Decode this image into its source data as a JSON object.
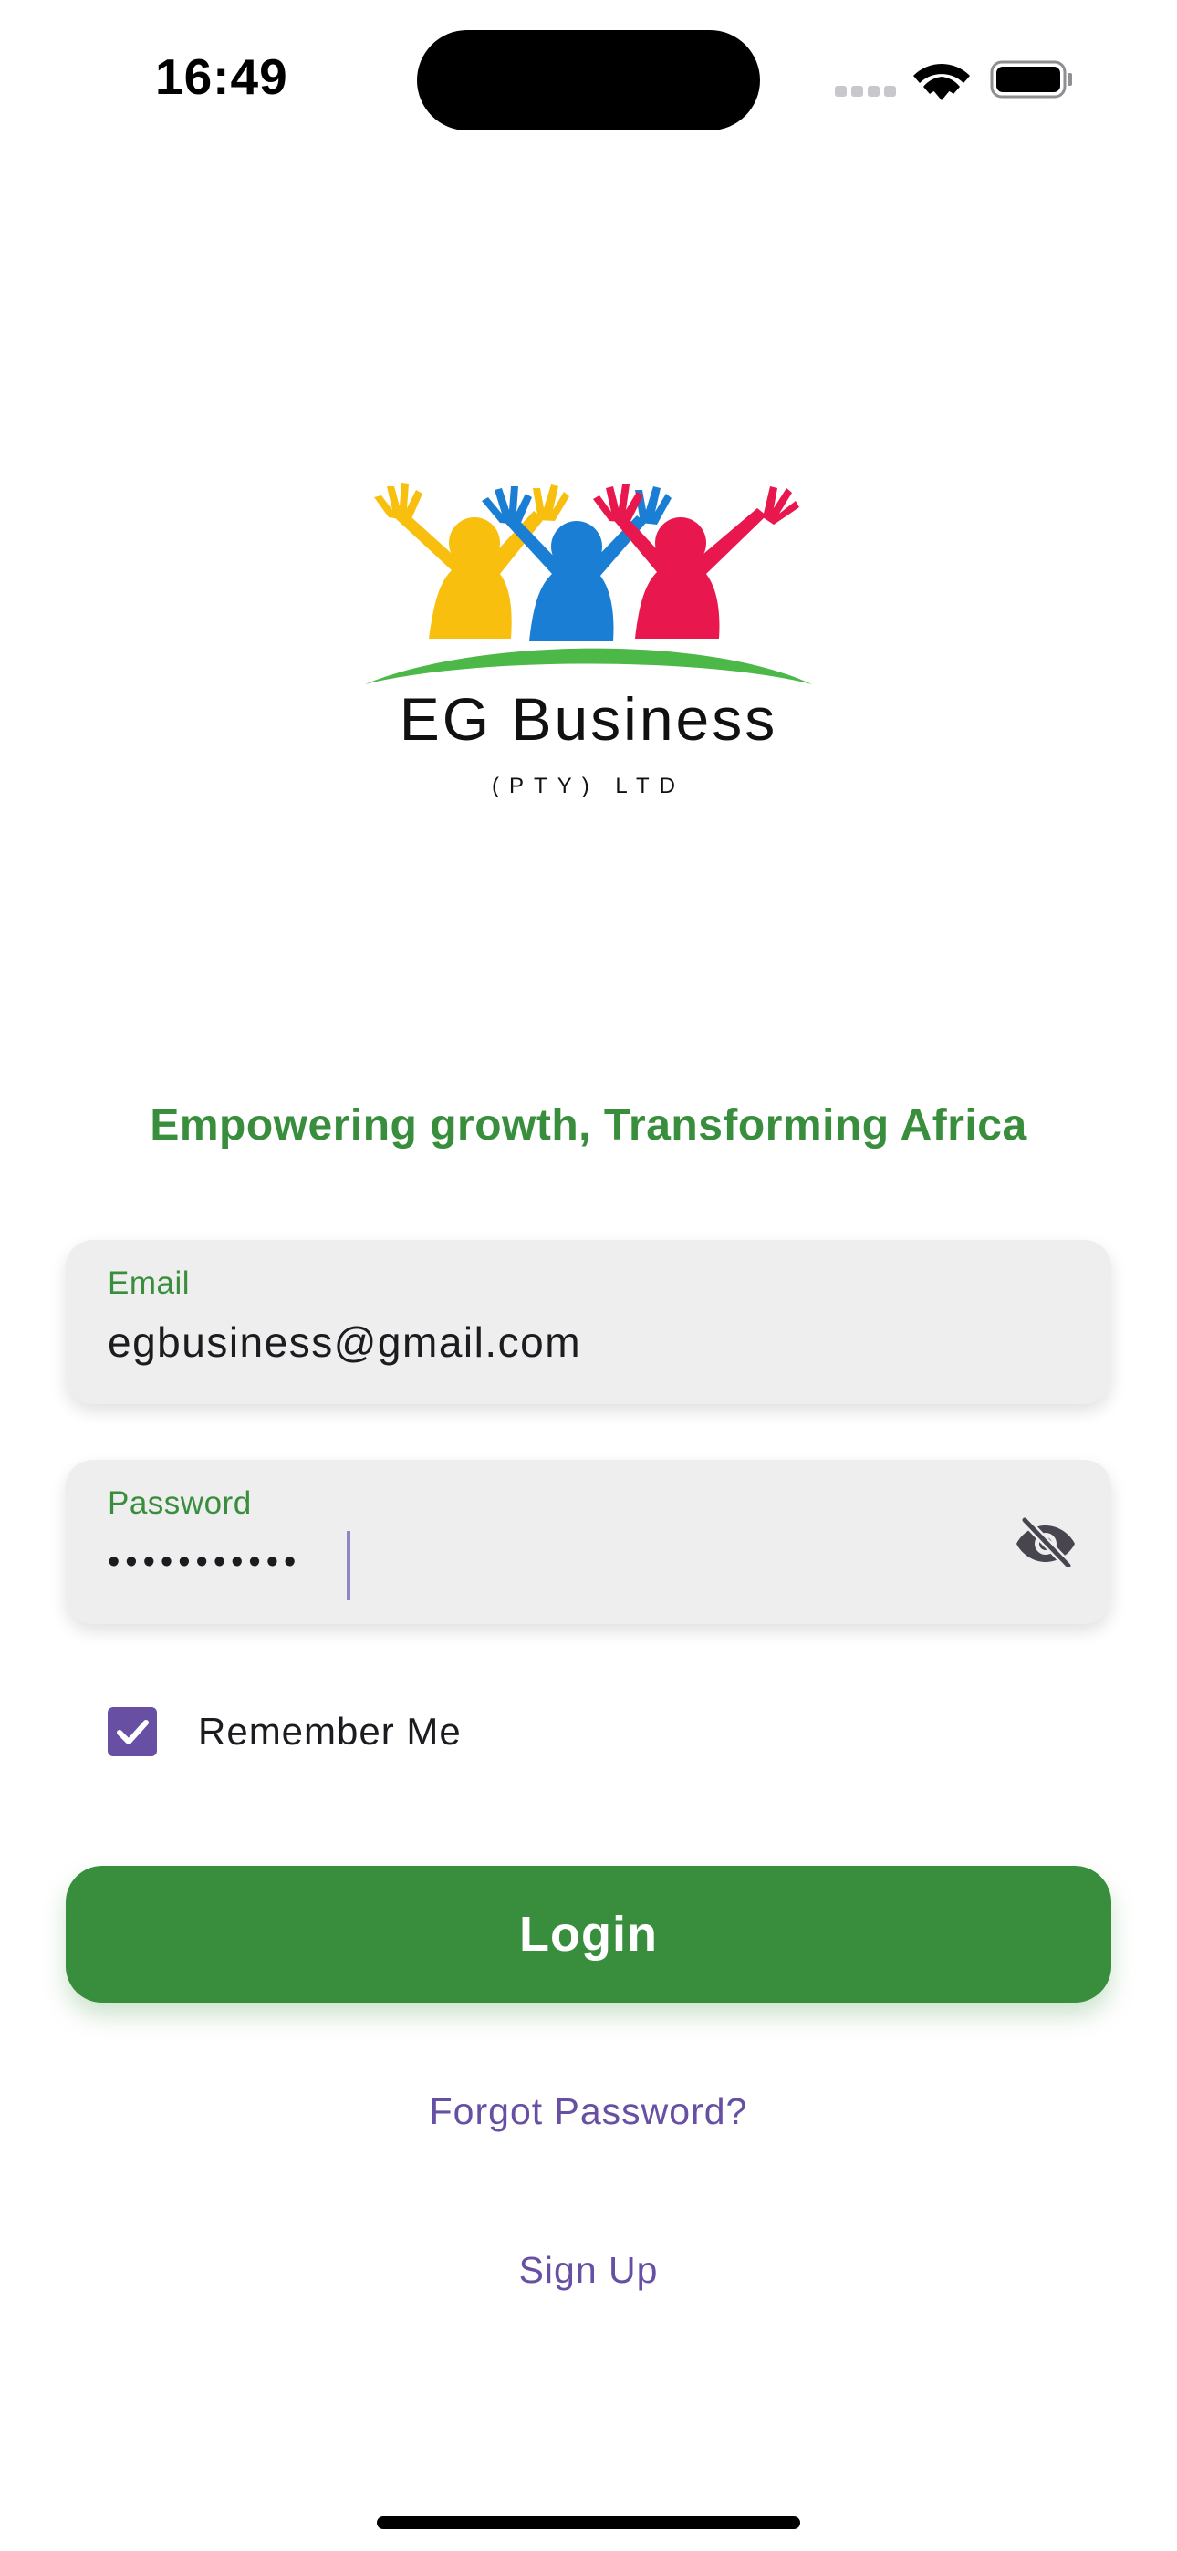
{
  "status_bar": {
    "time": "16:49",
    "icons": [
      "cellular-signal-icon",
      "wifi-icon",
      "battery-icon"
    ]
  },
  "logo": {
    "brand_name": "EG Business",
    "brand_sub": "(PTY) LTD",
    "colors": {
      "yellow": "#f9bf0f",
      "blue": "#1a7fd4",
      "red": "#e8174d",
      "green": "#4cb847"
    }
  },
  "tagline": "Empowering growth, Transforming Africa",
  "form": {
    "email": {
      "label": "Email",
      "value": "egbusiness@gmail.com"
    },
    "password": {
      "label": "Password",
      "masked_value": "•••••••••••",
      "toggle_icon": "eye-off-icon"
    },
    "remember_me": {
      "label": "Remember Me",
      "checked": true
    },
    "login_label": "Login",
    "forgot_password_label": "Forgot Password?",
    "sign_up_label": "Sign Up"
  },
  "colors": {
    "primary_green": "#388e3c",
    "accent_purple": "#6750a4",
    "field_background": "#eeeeee"
  }
}
